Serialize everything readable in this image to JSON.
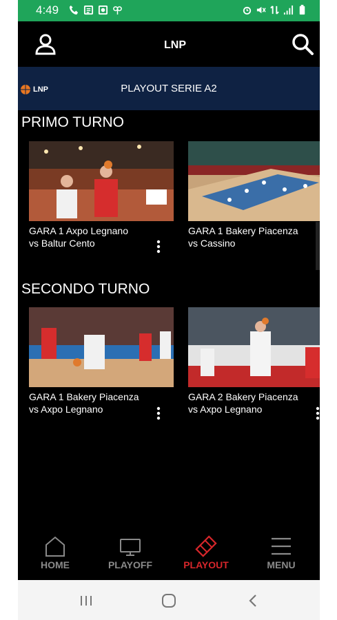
{
  "status_bar": {
    "time": "4:49",
    "left_icons": [
      "phone-icon",
      "message-icon",
      "photo-icon",
      "clover-icon"
    ],
    "right_icons": [
      "alarm-icon",
      "mute-icon",
      "data-icon",
      "signal-icon",
      "battery-icon"
    ],
    "color": "#1fa55a"
  },
  "header": {
    "logo_text": "LNP",
    "user_icon": "user-icon",
    "search_icon": "search-icon"
  },
  "banner": {
    "logo_text": "LNP",
    "title": "PLAYOUT SERIE A2",
    "color": "#0f2243"
  },
  "sections": [
    {
      "title": "PRIMO TURNO",
      "cards": [
        {
          "title_line1": "GARA 1 Axpo Legnano",
          "title_line2": "vs Baltur Cento"
        },
        {
          "title_line1": "GARA 1 Bakery Piacenza",
          "title_line2": "vs Cassino"
        }
      ]
    },
    {
      "title": "SECONDO TURNO",
      "cards": [
        {
          "title_line1": "GARA 1 Bakery Piacenza",
          "title_line2": "vs Axpo Legnano"
        },
        {
          "title_line1": "GARA 2 Bakery Piacenza",
          "title_line2": "vs Axpo Legnano"
        }
      ]
    }
  ],
  "bottom_nav": {
    "items": [
      {
        "label": "HOME",
        "icon": "home-icon",
        "active": false
      },
      {
        "label": "PLAYOFF",
        "icon": "tv-icon",
        "active": false
      },
      {
        "label": "PLAYOUT",
        "icon": "ticket-icon",
        "active": true
      },
      {
        "label": "MENU",
        "icon": "menu-icon",
        "active": false
      }
    ],
    "active_color": "#d7262b",
    "inactive_color": "#8a8a8a"
  },
  "system_nav": {
    "buttons": [
      "recents-icon",
      "home-circle-icon",
      "back-icon"
    ]
  }
}
